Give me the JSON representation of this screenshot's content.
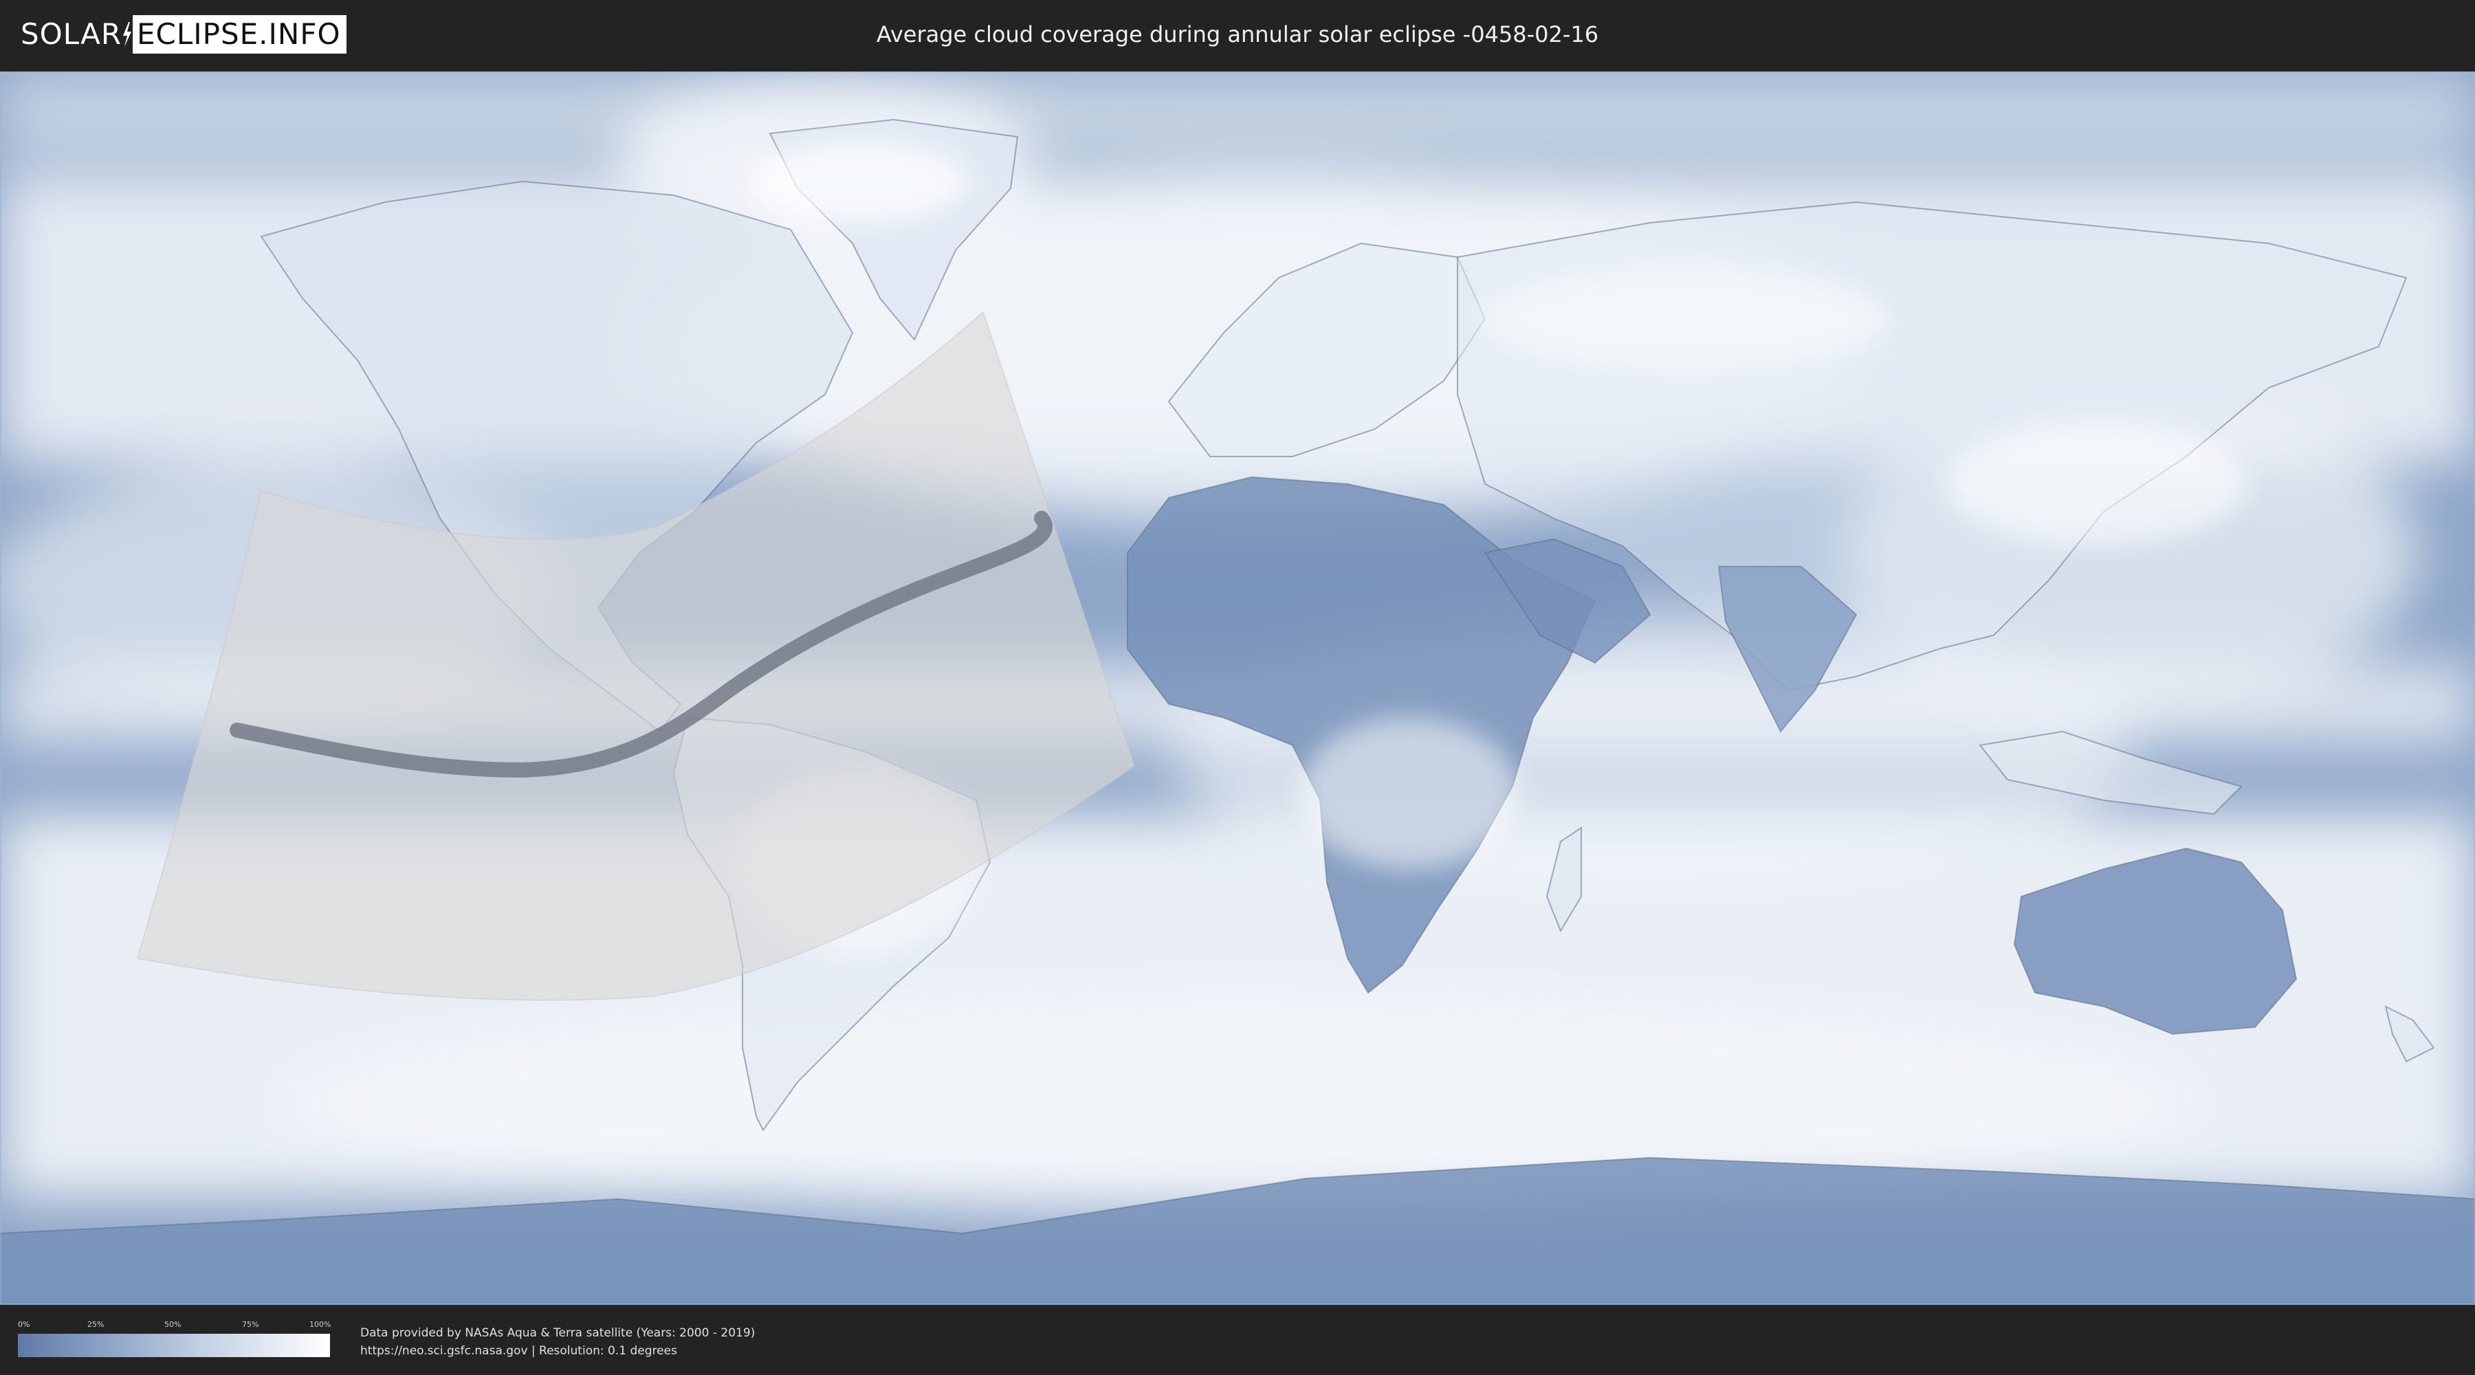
{
  "header": {
    "logo": {
      "solar": "SOLAR",
      "eclipse": "ECLIPSE.INFO"
    },
    "title": "Average cloud coverage during annular solar eclipse -0458-02-16"
  },
  "map": {
    "colors": {
      "ocean_clear": "#8ea6c8",
      "cloud": "#f3f6fa",
      "land_clear": "#6f89b3",
      "border": "#5d6f88",
      "eclipse_zone": "#d8d8d8",
      "eclipse_path": "#6e7683"
    }
  },
  "footer": {
    "legend": {
      "ticks": [
        "0%",
        "25%",
        "50%",
        "75%",
        "100%"
      ],
      "tick_values": [
        0,
        25,
        50,
        75,
        100
      ],
      "color_low": "#5f7aa6",
      "color_high": "#ffffff"
    },
    "source_line1": "Data provided by NASAs Aqua & Terra satellite (Years: 2000 - 2019)",
    "source_line2": "https://neo.sci.gsfc.nasa.gov | Resolution: 0.1 degrees"
  }
}
